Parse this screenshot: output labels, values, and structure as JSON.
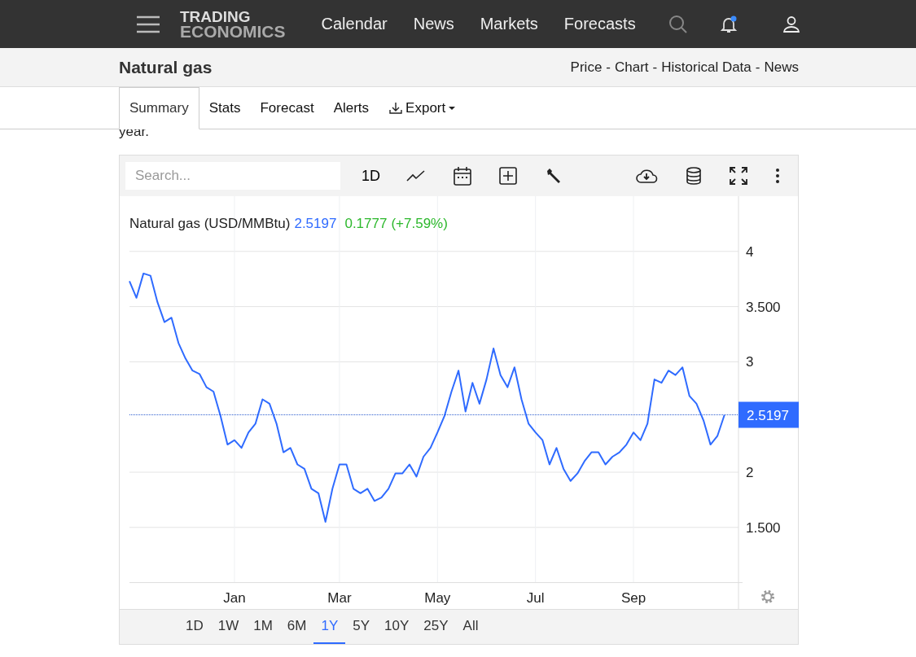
{
  "header": {
    "logo_top": "TRADING",
    "logo_bottom": "ECONOMICS",
    "nav": [
      "Calendar",
      "News",
      "Markets",
      "Forecasts"
    ]
  },
  "title_bar": {
    "title": "Natural gas",
    "links": [
      "Price",
      "Chart",
      "Historical Data",
      "News"
    ],
    "separator": "-"
  },
  "tabs": [
    {
      "label": "Summary",
      "selected": true,
      "kind": "tab"
    },
    {
      "label": "Stats",
      "selected": false,
      "kind": "tab"
    },
    {
      "label": "Forecast",
      "selected": false,
      "kind": "tab"
    },
    {
      "label": "Alerts",
      "selected": false,
      "kind": "tab"
    },
    {
      "label": "Export",
      "selected": false,
      "kind": "menu"
    }
  ],
  "intro_fragment": "year.",
  "chart_panel": {
    "search": {
      "placeholder": "Search..."
    },
    "interval": "1D",
    "legend": {
      "name": "Natural gas (USD/MMBtu)",
      "price": "2.5197",
      "change": "0.1777",
      "change_pct": "(+7.59%)"
    },
    "chart_data": {
      "type": "line",
      "categories": [
        null,
        null,
        null,
        null,
        null,
        null,
        null,
        null,
        null,
        null,
        null,
        null,
        null,
        null,
        null,
        "Jan",
        null,
        null,
        null,
        null,
        null,
        null,
        null,
        null,
        null,
        null,
        null,
        null,
        null,
        null,
        "Mar",
        null,
        null,
        null,
        null,
        null,
        null,
        null,
        null,
        null,
        null,
        null,
        null,
        null,
        "May",
        null,
        null,
        null,
        null,
        null,
        null,
        null,
        null,
        null,
        null,
        null,
        null,
        null,
        "Jul",
        null,
        null,
        null,
        null,
        null,
        null,
        null,
        null,
        null,
        null,
        null,
        null,
        null,
        "Sep",
        null,
        null,
        null,
        null,
        null,
        null,
        null,
        null,
        null,
        null,
        null,
        null,
        null
      ],
      "series": [
        {
          "color": "#2f6bff",
          "values": [
            3.73,
            3.58,
            3.8,
            3.78,
            3.54,
            3.36,
            3.4,
            3.17,
            3.03,
            2.92,
            2.89,
            2.77,
            2.73,
            2.51,
            2.25,
            2.29,
            2.22,
            2.36,
            2.44,
            2.66,
            2.62,
            2.44,
            2.18,
            2.22,
            2.07,
            2.03,
            1.85,
            1.81,
            1.55,
            1.85,
            2.07,
            2.07,
            1.85,
            1.81,
            1.85,
            1.74,
            1.77,
            1.85,
            1.99,
            1.99,
            2.07,
            1.96,
            2.14,
            2.22,
            2.36,
            2.51,
            2.73,
            2.92,
            2.55,
            2.81,
            2.62,
            2.84,
            3.12,
            2.88,
            2.77,
            2.95,
            2.66,
            2.44,
            2.36,
            2.29,
            2.07,
            2.22,
            2.03,
            1.92,
            1.99,
            2.1,
            2.18,
            2.18,
            2.07,
            2.14,
            2.18,
            2.25,
            2.36,
            2.29,
            2.44,
            2.84,
            2.81,
            2.92,
            2.88,
            2.95,
            2.69,
            2.62,
            2.47,
            2.25,
            2.33,
            2.52
          ]
        }
      ],
      "ylim": [
        1,
        4.5
      ],
      "grid": true,
      "ref_lines": [
        {
          "axis": "y",
          "value": 2.5197,
          "label": "2.5197"
        }
      ],
      "yticks": [
        {
          "value": 1.5,
          "label": "1.500"
        },
        {
          "value": 2,
          "label": "2"
        },
        {
          "value": 3,
          "label": "3"
        },
        {
          "value": 3.5,
          "label": "3.500"
        },
        {
          "value": 4,
          "label": "4"
        }
      ]
    },
    "ranges": [
      {
        "label": "1D",
        "selected": false
      },
      {
        "label": "1W",
        "selected": false
      },
      {
        "label": "1M",
        "selected": false
      },
      {
        "label": "6M",
        "selected": false
      },
      {
        "label": "1Y",
        "selected": true
      },
      {
        "label": "5Y",
        "selected": false
      },
      {
        "label": "10Y",
        "selected": false
      },
      {
        "label": "25Y",
        "selected": false
      },
      {
        "label": "All",
        "selected": false
      }
    ]
  }
}
